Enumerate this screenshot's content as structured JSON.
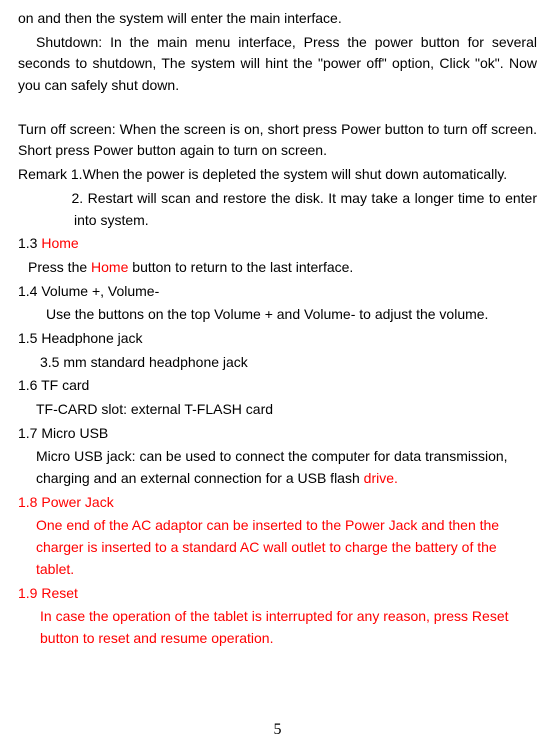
{
  "p1": "on and then the system will enter the main interface.",
  "p2": "Shutdown: In the main menu interface, Press the power button for several seconds to shutdown, The system will hint the \"power off\" option, Click \"ok\". Now you can safely shut down.",
  "p3": "Turn off screen: When the screen is on, short press Power button to turn off screen. Short press Power button again to turn on screen.",
  "p4": "Remark 1.When the power is depleted the system will shut down automatically.",
  "p5": "2. Restart will scan and restore the disk. It may take a longer time to enter into system.",
  "s13_prefix": "1.3 ",
  "s13_home": "Home",
  "s13_body_a": "Press the ",
  "s13_body_b": "Home",
  "s13_body_c": " button to return to the last interface.",
  "s14_title": "1.4 Volume +, Volume-",
  "s14_body": "Use the buttons on the top Volume + and Volume- to adjust the volume.",
  "s15_title": "1.5 Headphone jack",
  "s15_body": "3.5 mm standard headphone jack",
  "s16_title": "1.6 TF card",
  "s16_body": "TF-CARD slot: external T-FLASH card",
  "s17_title": "1.7 Micro USB",
  "s17_body_a": "Micro USB jack: can be used to connect the computer for data transmission, charging and an external connection for a USB flash ",
  "s17_body_b": "drive.",
  "s18_title": "1.8 Power Jack",
  "s18_body": "One end of the AC adaptor can be inserted to the Power Jack and then the charger is inserted to a standard AC wall outlet to charge the battery of the tablet.",
  "s19_title": "1.9 Reset",
  "s19_body": "In case the operation of the tablet is interrupted for any reason, press Reset button to reset and resume operation.",
  "page_number": "5"
}
